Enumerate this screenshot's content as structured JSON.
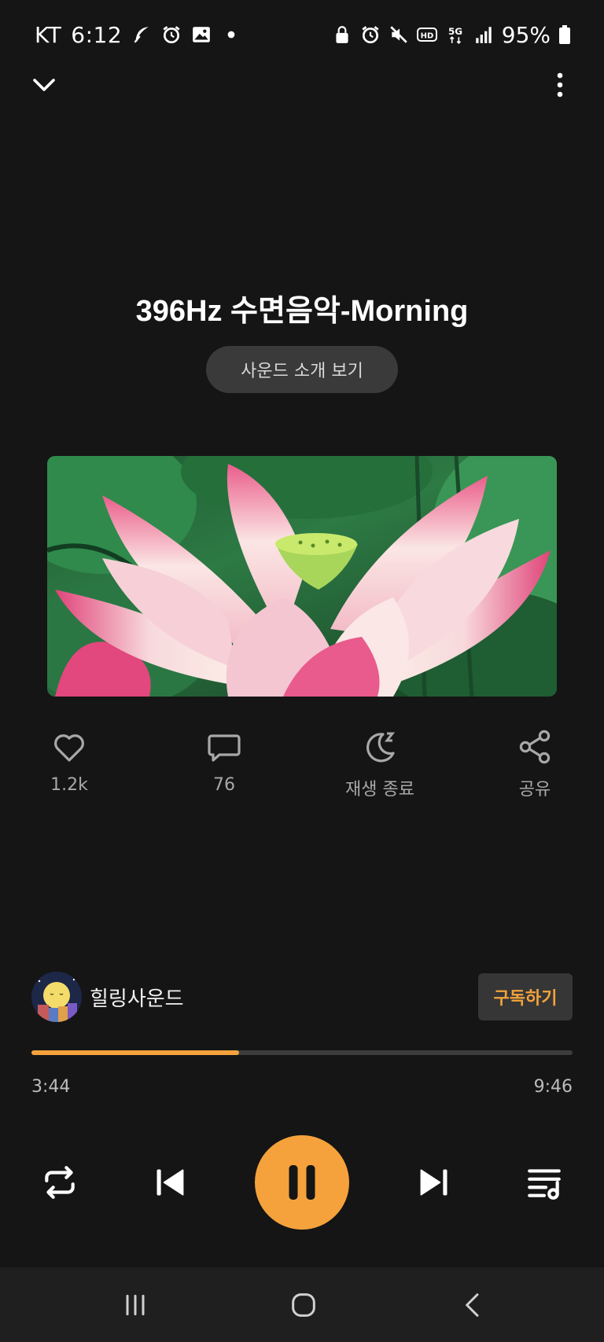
{
  "status_bar": {
    "carrier": "KT",
    "time": "6:12",
    "battery": "95%",
    "left_icons": [
      "feather-icon",
      "alarm-icon",
      "gallery-icon",
      "dot-icon"
    ],
    "right_icons": [
      "lock-icon",
      "alarm-icon",
      "mute-icon",
      "hd-icon",
      "5g-icon",
      "signal-icon",
      "battery-icon"
    ]
  },
  "track": {
    "title": "396Hz 수면음악-Morning",
    "intro_label": "사운드 소개 보기"
  },
  "actions": {
    "like_count": "1.2k",
    "comment_count": "76",
    "sleep_timer_label": "재생 종료",
    "share_label": "공유"
  },
  "channel": {
    "name": "힐링사운드",
    "subscribe_label": "구독하기"
  },
  "playback": {
    "elapsed": "3:44",
    "total": "9:46",
    "progress_fraction": 0.383,
    "state": "playing"
  },
  "colors": {
    "accent": "#f5a23c",
    "background": "#151515"
  },
  "icons": {
    "collapse": "chevron-down-icon",
    "more": "more-vertical-icon",
    "like": "heart-icon",
    "comment": "comment-icon",
    "sleep": "moon-icon",
    "share": "share-icon",
    "repeat": "repeat-icon",
    "previous": "skip-previous-icon",
    "pause": "pause-icon",
    "next": "skip-next-icon",
    "queue": "playlist-icon"
  }
}
